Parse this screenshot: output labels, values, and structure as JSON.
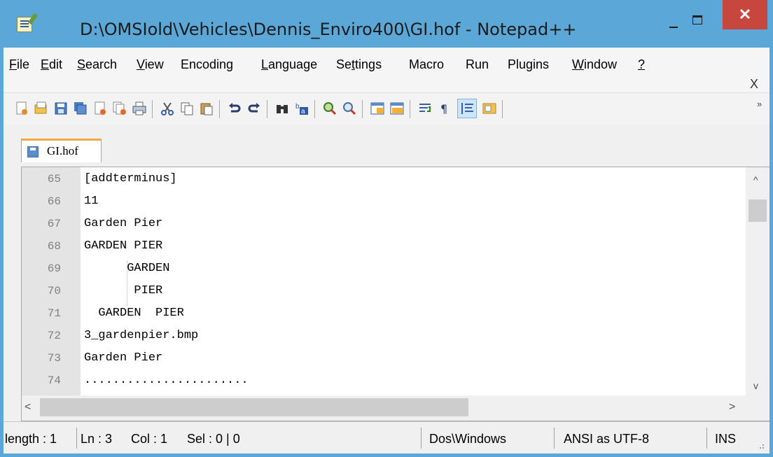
{
  "window": {
    "title": "D:\\OMSIold\\Vehicles\\Dennis_Enviro400\\GI.hof - Notepad++",
    "close_glyph": "✕"
  },
  "menu": {
    "items": [
      {
        "ul": "F",
        "rest": "ile"
      },
      {
        "ul": "E",
        "rest": "dit"
      },
      {
        "ul": "S",
        "rest": "earch"
      },
      {
        "ul": "V",
        "rest": "iew"
      },
      {
        "ul": "",
        "rest": "Encoding"
      },
      {
        "ul": "L",
        "rest": "anguage"
      },
      {
        "pre": "Se",
        "ul": "t",
        "rest": "tings"
      },
      {
        "ul": "",
        "rest": "Macro"
      },
      {
        "ul": "",
        "rest": "Run"
      },
      {
        "ul": "",
        "rest": "Plugins"
      },
      {
        "ul": "W",
        "rest": "indow"
      },
      {
        "ul": "?",
        "rest": ""
      }
    ],
    "close_glyph": "X"
  },
  "toolbar": {
    "icons": [
      "new-file-icon",
      "open-file-icon",
      "save-icon",
      "save-all-icon",
      "close-icon",
      "close-all-icon",
      "print-icon",
      "cut-icon",
      "copy-icon",
      "paste-icon",
      "undo-icon",
      "redo-icon",
      "find-icon",
      "replace-icon",
      "zoom-in-icon",
      "zoom-out-icon",
      "sync-vertical-icon",
      "sync-horizontal-icon",
      "word-wrap-icon",
      "show-all-chars-icon",
      "indent-guide-icon",
      "user-defined-language-icon"
    ],
    "more_glyph": "»"
  },
  "tab": {
    "label": "GI.hof"
  },
  "editor": {
    "line_numbers": [
      "65",
      "66",
      "67",
      "68",
      "69",
      "70",
      "71",
      "72",
      "73",
      "74"
    ],
    "lines": [
      "[addterminus]",
      "11",
      "Garden Pier",
      "GARDEN PIER",
      "      GARDEN",
      "       PIER",
      "  GARDEN  PIER",
      "3_gardenpier.bmp",
      "Garden Pier",
      "......................."
    ],
    "scroll": {
      "up": "^",
      "down": "v",
      "left": "<",
      "right": ">"
    }
  },
  "status": {
    "length": "length : 1",
    "ln": "Ln : 3",
    "col": "Col : 1",
    "sel": "Sel : 0 | 0",
    "eol": "Dos\\Windows",
    "encoding": "ANSI as UTF-8",
    "mode": "INS"
  },
  "colors": {
    "titlebar": "#5ba7d8",
    "close_button": "#c7463e",
    "tab_accent": "#f3a63c",
    "gutter": "#e4e4e4"
  }
}
